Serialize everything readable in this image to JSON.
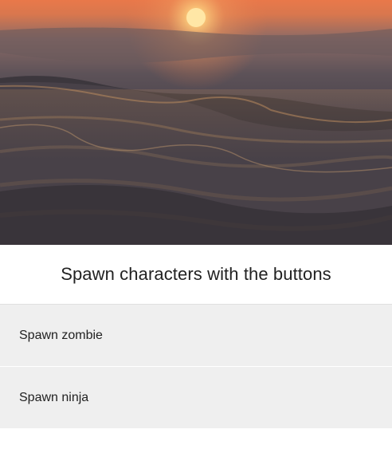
{
  "hero": {
    "image": "ocean-sunset-waves"
  },
  "caption": "Spawn characters with the buttons",
  "buttons": [
    {
      "label": "Spawn zombie"
    },
    {
      "label": "Spawn ninja"
    }
  ],
  "colors": {
    "button_bg": "#efefef",
    "text": "#222222",
    "page_bg": "#ffffff"
  }
}
